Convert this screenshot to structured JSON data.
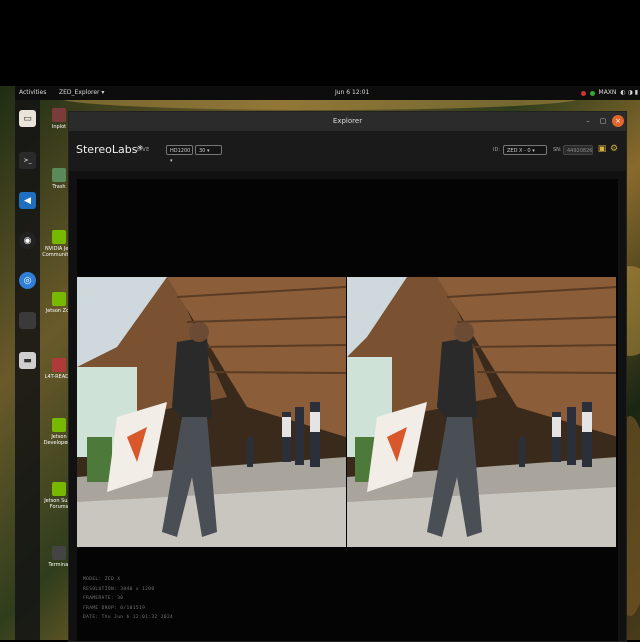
{
  "topbar": {
    "activities": "Activities",
    "app_menu": "ZED_Explorer ▾",
    "clock": "Jun 6 12:01",
    "power_mode": "MAXN",
    "status_glyphs": "◐ ◑ ▮"
  },
  "dock": {
    "items": [
      {
        "name": "files",
        "glyph": "▭"
      },
      {
        "name": "terminal",
        "glyph": ">_"
      },
      {
        "name": "vscode",
        "glyph": "◀"
      },
      {
        "name": "obs",
        "glyph": "◉"
      },
      {
        "name": "chromium",
        "glyph": "◎"
      },
      {
        "name": "drive",
        "glyph": "▬"
      }
    ]
  },
  "desktop_icons": [
    "Inplot",
    "Trash",
    "NVIDIA Jets Community F",
    "Jetson Zoo",
    "L4T-READM",
    "Jetson Developer Z",
    "Jetson Supp Forums",
    "Terminal"
  ],
  "window": {
    "title": "Explorer",
    "controls": {
      "minimize": "–",
      "maximize": "▢",
      "close": "×"
    }
  },
  "header": {
    "brand": "StereoLabs*",
    "live": "LIVE",
    "resolution": "HD1200 ▾",
    "fps": "30 ▾",
    "id_label": "ID:",
    "camera": "ZED X - 0 ▾",
    "sn_label": "SN:",
    "serial": "44920826"
  },
  "info": {
    "model": "MODEL: ZED X",
    "resolution": "RESOLUTION: 3840 x 1200",
    "framerate": "FRAMERATE: 30",
    "frame_drop": "FRAME DROP: 0/101519",
    "date": "DATE: Thu Jun 6 12:01:32 2024"
  },
  "colors": {
    "background": "#000000",
    "window_bg": "#111111",
    "accent": "#d8b23a",
    "close_button": "#e0662c"
  }
}
